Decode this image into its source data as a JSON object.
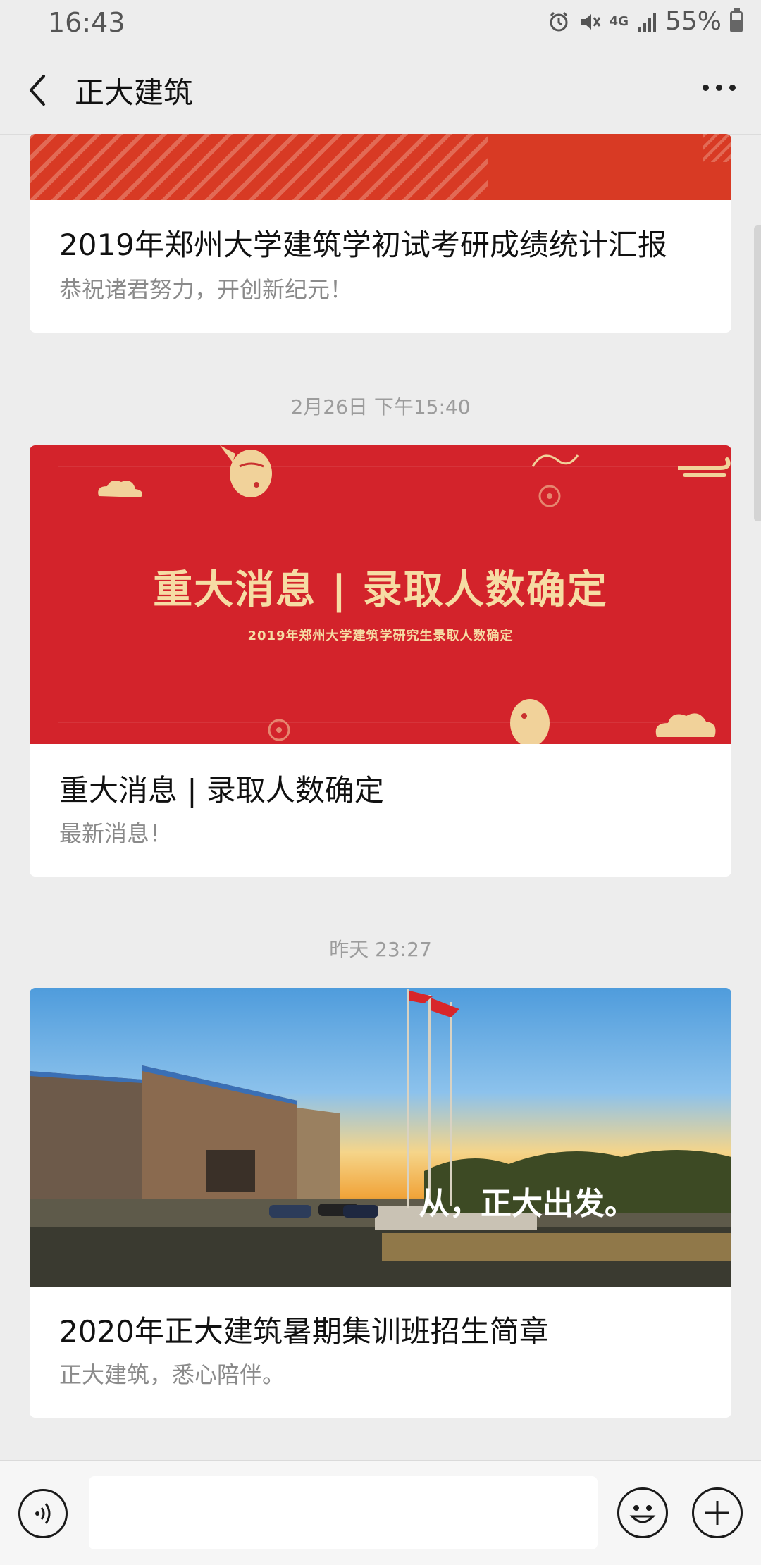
{
  "status_bar": {
    "time": "16:43",
    "network": "4G",
    "battery": "55%",
    "battery_level": 0.55
  },
  "nav": {
    "title": "正大建筑",
    "back_icon": "chevron-left-icon",
    "more_icon": "more-dots-icon"
  },
  "messages": [
    {
      "cover_style": "red-stripes",
      "title": "2019年郑州大学建筑学初试考研成绩统计汇报",
      "subtitle": "恭祝诸君努力，开创新纪元！"
    },
    {
      "timestamp": "2月26日 下午15:40",
      "cover_headline": "重大消息 | 录取人数确定",
      "cover_subheadline": "2019年郑州大学建筑学研究生录取人数确定",
      "title": "重大消息 | 录取人数确定",
      "subtitle": "最新消息！"
    },
    {
      "timestamp": "昨天 23:27",
      "cover_overlay": "从，正大出发。",
      "title": "2020年正大建筑暑期集训班招生简章",
      "subtitle": "正大建筑，悉心陪伴。"
    }
  ],
  "input_bar": {
    "voice_icon": "voice-icon",
    "emoji_icon": "emoji-icon",
    "plus_icon": "plus-icon"
  },
  "colors": {
    "background": "#ededed",
    "card_red": "#d3232b",
    "card_gold_text": "#f6dca4"
  }
}
